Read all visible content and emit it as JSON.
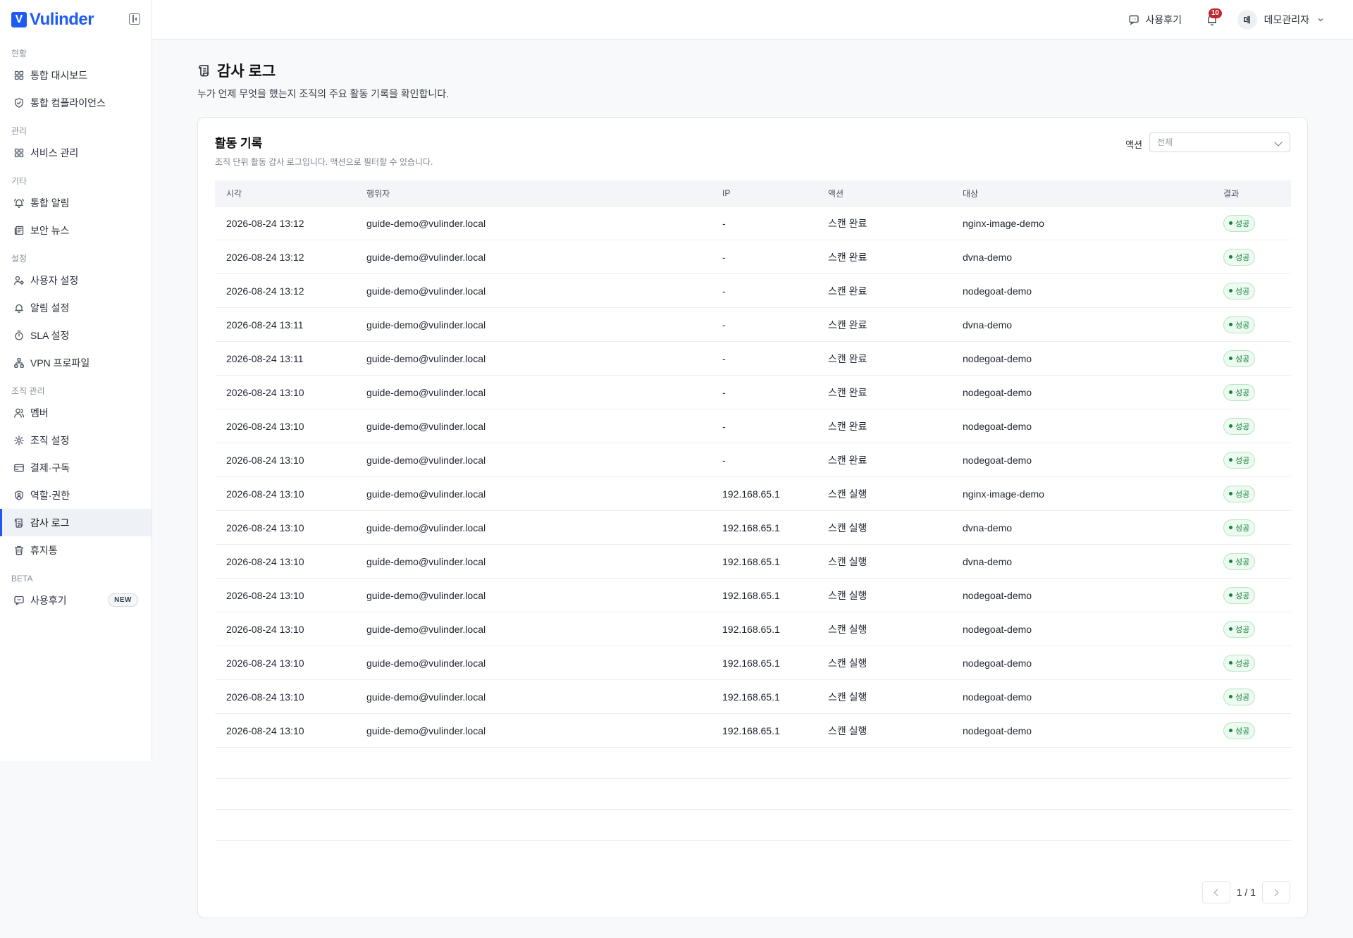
{
  "brand": {
    "name": "Vulinder",
    "mark": "V"
  },
  "sidebar": {
    "sections": [
      {
        "title": "현황",
        "items": [
          {
            "label": "통합 대시보드",
            "icon": "dashboard-icon"
          },
          {
            "label": "통합 컴플라이언스",
            "icon": "shield-check-icon"
          }
        ]
      },
      {
        "title": "관리",
        "items": [
          {
            "label": "서비스 관리",
            "icon": "grid-icon"
          }
        ]
      },
      {
        "title": "기타",
        "items": [
          {
            "label": "통합 알림",
            "icon": "bell-ring-icon"
          },
          {
            "label": "보안 뉴스",
            "icon": "newspaper-icon"
          }
        ]
      },
      {
        "title": "설정",
        "items": [
          {
            "label": "사용자 설정",
            "icon": "user-cog-icon"
          },
          {
            "label": "알림 설정",
            "icon": "bell-icon"
          },
          {
            "label": "SLA 설정",
            "icon": "timer-icon"
          },
          {
            "label": "VPN 프로파일",
            "icon": "network-icon"
          }
        ]
      },
      {
        "title": "조직 관리",
        "items": [
          {
            "label": "멤버",
            "icon": "users-icon"
          },
          {
            "label": "조직 설정",
            "icon": "gear-icon"
          },
          {
            "label": "결제·구독",
            "icon": "credit-card-icon"
          },
          {
            "label": "역할·권한",
            "icon": "shield-user-icon"
          },
          {
            "label": "감사 로그",
            "icon": "scroll-icon",
            "active": true
          },
          {
            "label": "휴지통",
            "icon": "trash-icon"
          }
        ]
      },
      {
        "title": "BETA",
        "items": [
          {
            "label": "사용후기",
            "icon": "message-icon",
            "badge": "NEW"
          }
        ]
      }
    ]
  },
  "topbar": {
    "review_label": "사용후기",
    "notification_count": "10",
    "avatar_initial": "데",
    "user_name": "데모관리자"
  },
  "page": {
    "title": "감사 로그",
    "description": "누가 언제 무엇을 했는지 조직의 주요 활동 기록을 확인합니다."
  },
  "card": {
    "title": "활동 기록",
    "subtitle": "조직 단위 활동 감사 로그입니다. 액션으로 필터할 수 있습니다.",
    "filter_label": "액션",
    "filter_value": "전체"
  },
  "table": {
    "columns": [
      "시각",
      "행위자",
      "IP",
      "액션",
      "대상",
      "결과"
    ],
    "rows": [
      {
        "time": "2026-08-24 13:12",
        "actor": "guide-demo@vulinder.local",
        "ip": "-",
        "action": "스캔 완료",
        "target": "nginx-image-demo",
        "result": "성공"
      },
      {
        "time": "2026-08-24 13:12",
        "actor": "guide-demo@vulinder.local",
        "ip": "-",
        "action": "스캔 완료",
        "target": "dvna-demo",
        "result": "성공"
      },
      {
        "time": "2026-08-24 13:12",
        "actor": "guide-demo@vulinder.local",
        "ip": "-",
        "action": "스캔 완료",
        "target": "nodegoat-demo",
        "result": "성공"
      },
      {
        "time": "2026-08-24 13:11",
        "actor": "guide-demo@vulinder.local",
        "ip": "-",
        "action": "스캔 완료",
        "target": "dvna-demo",
        "result": "성공"
      },
      {
        "time": "2026-08-24 13:11",
        "actor": "guide-demo@vulinder.local",
        "ip": "-",
        "action": "스캔 완료",
        "target": "nodegoat-demo",
        "result": "성공"
      },
      {
        "time": "2026-08-24 13:10",
        "actor": "guide-demo@vulinder.local",
        "ip": "-",
        "action": "스캔 완료",
        "target": "nodegoat-demo",
        "result": "성공"
      },
      {
        "time": "2026-08-24 13:10",
        "actor": "guide-demo@vulinder.local",
        "ip": "-",
        "action": "스캔 완료",
        "target": "nodegoat-demo",
        "result": "성공"
      },
      {
        "time": "2026-08-24 13:10",
        "actor": "guide-demo@vulinder.local",
        "ip": "-",
        "action": "스캔 완료",
        "target": "nodegoat-demo",
        "result": "성공"
      },
      {
        "time": "2026-08-24 13:10",
        "actor": "guide-demo@vulinder.local",
        "ip": "192.168.65.1",
        "action": "스캔 실행",
        "target": "nginx-image-demo",
        "result": "성공"
      },
      {
        "time": "2026-08-24 13:10",
        "actor": "guide-demo@vulinder.local",
        "ip": "192.168.65.1",
        "action": "스캔 실행",
        "target": "dvna-demo",
        "result": "성공"
      },
      {
        "time": "2026-08-24 13:10",
        "actor": "guide-demo@vulinder.local",
        "ip": "192.168.65.1",
        "action": "스캔 실행",
        "target": "dvna-demo",
        "result": "성공"
      },
      {
        "time": "2026-08-24 13:10",
        "actor": "guide-demo@vulinder.local",
        "ip": "192.168.65.1",
        "action": "스캔 실행",
        "target": "nodegoat-demo",
        "result": "성공"
      },
      {
        "time": "2026-08-24 13:10",
        "actor": "guide-demo@vulinder.local",
        "ip": "192.168.65.1",
        "action": "스캔 실행",
        "target": "nodegoat-demo",
        "result": "성공"
      },
      {
        "time": "2026-08-24 13:10",
        "actor": "guide-demo@vulinder.local",
        "ip": "192.168.65.1",
        "action": "스캔 실행",
        "target": "nodegoat-demo",
        "result": "성공"
      },
      {
        "time": "2026-08-24 13:10",
        "actor": "guide-demo@vulinder.local",
        "ip": "192.168.65.1",
        "action": "스캔 실행",
        "target": "nodegoat-demo",
        "result": "성공"
      },
      {
        "time": "2026-08-24 13:10",
        "actor": "guide-demo@vulinder.local",
        "ip": "192.168.65.1",
        "action": "스캔 실행",
        "target": "nodegoat-demo",
        "result": "성공"
      }
    ]
  },
  "pagination": {
    "label": "1 / 1"
  },
  "colors": {
    "brand": "#1e5bf2",
    "success": "#16813e",
    "notification": "#c0282d"
  }
}
